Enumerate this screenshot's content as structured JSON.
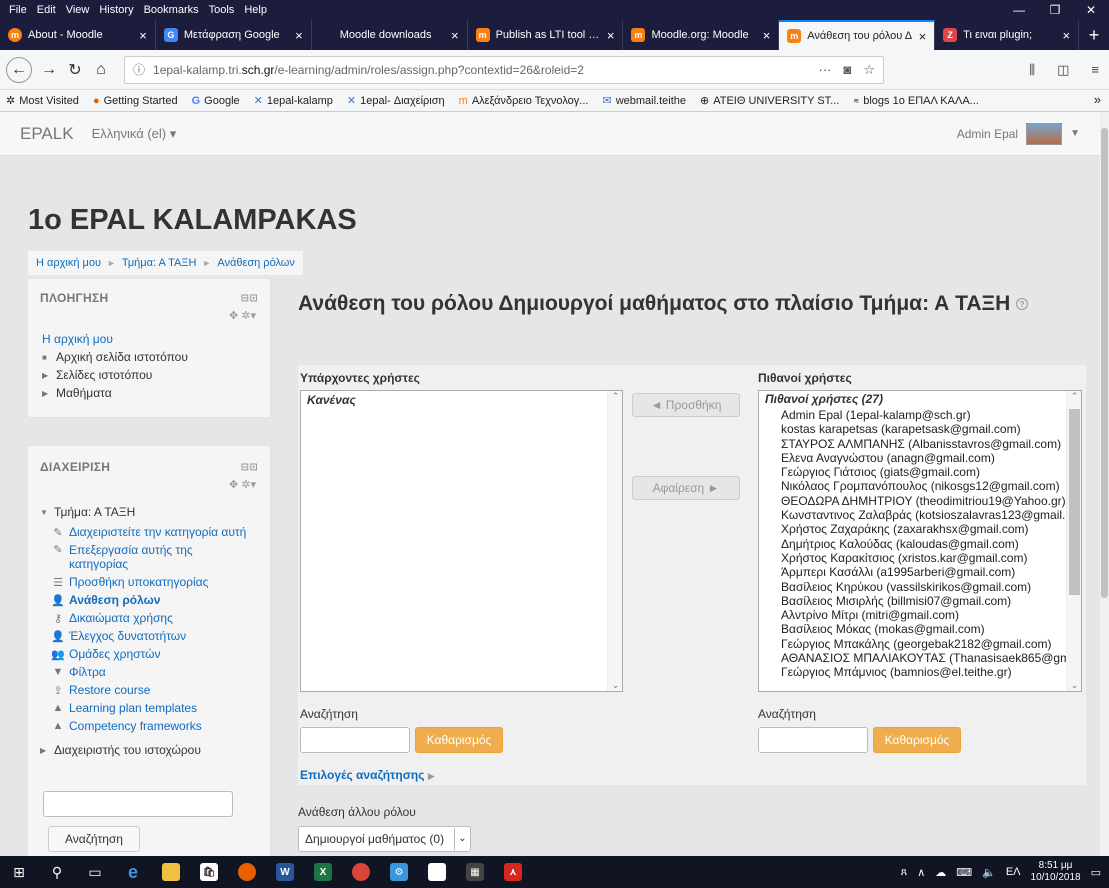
{
  "menubar": {
    "items": [
      "File",
      "Edit",
      "View",
      "History",
      "Bookmarks",
      "Tools",
      "Help"
    ]
  },
  "tabs": [
    {
      "title": "About - Moodle",
      "icon": "moodle-icon",
      "color": "#f98012"
    },
    {
      "title": "Μετάφραση Google",
      "icon": "google-translate-icon",
      "color": "#4285f4"
    },
    {
      "title": "Moodle downloads",
      "icon": "page-icon",
      "color": "#1c1c3c"
    },
    {
      "title": "Publish as LTI tool - M",
      "icon": "moodle-icon",
      "color": "#f98012"
    },
    {
      "title": "Moodle.org: Moodle",
      "icon": "moodle-icon",
      "color": "#f98012"
    },
    {
      "title": "Ανάθεση του ρόλου Δ",
      "icon": "moodle-icon",
      "color": "#f98012"
    },
    {
      "title": "Τι ειναι plugin;",
      "icon": "pin-icon",
      "color": "#e0454c"
    }
  ],
  "navbar": {
    "url_prefix": "1epal-kalamp.tri.",
    "url_domain": "sch.gr",
    "url_suffix": "/e-learning/admin/roles/assign.php?contextid=26&roleid=2"
  },
  "bookmarks": [
    {
      "label": "Most Visited",
      "icon": "gear-icon"
    },
    {
      "label": "Getting Started",
      "icon": "firefox-icon"
    },
    {
      "label": "Google",
      "icon": "google-icon"
    },
    {
      "label": "1epal-kalamp",
      "icon": "moodle-icon"
    },
    {
      "label": "1epal- Διαχείριση",
      "icon": "moodle-icon"
    },
    {
      "label": "Αλεξάνδρειο Τεχνολογ...",
      "icon": "moodle-icon"
    },
    {
      "label": "webmail.teithe",
      "icon": "mail-icon"
    },
    {
      "label": "ATEIΘ UNIVERSITY ST...",
      "icon": "globe-icon"
    },
    {
      "label": "blogs 1ο ΕΠΑΛ ΚΑΛΑ...",
      "icon": "blog-icon"
    }
  ],
  "topnav": {
    "brand": "EPALK",
    "language": "Ελληνικά (el) ▾",
    "user": "Admin Epal"
  },
  "page": {
    "title": "1o EPAL KALAMPAKAS",
    "breadcrumb": [
      "Η αρχική μου",
      "Τμήμα: Α ΤΑΞΗ",
      "Ανάθεση ρόλων"
    ]
  },
  "nav_block": {
    "title": "ΠΛΟΗΓΗΣΗ",
    "home": "Η αρχική μου",
    "items": [
      "Αρχική σελίδα ιστοτόπου",
      "Σελίδες ιστοτόπου",
      "Μαθήματα"
    ]
  },
  "admin_block": {
    "title": "ΔΙΑΧΕΙΡΙΣΗ",
    "category": "Τμήμα: Α ΤΑΞΗ",
    "items": [
      {
        "label": "Διαχειριστείτε την κατηγορία αυτή",
        "icon": "pencil-icon"
      },
      {
        "label": "Επεξεργασία αυτής της κατηγορίας",
        "icon": "pencil-icon"
      },
      {
        "label": "Προσθήκη υποκατηγορίας",
        "icon": "list-icon"
      },
      {
        "label": "Ανάθεση ρόλων",
        "icon": "user-icon"
      },
      {
        "label": "Δικαιώματα χρήσης",
        "icon": "key-icon"
      },
      {
        "label": "Έλεγχος δυνατοτήτων",
        "icon": "user-check-icon"
      },
      {
        "label": "Ομάδες χρηστών",
        "icon": "users-icon"
      },
      {
        "label": "Φίλτρα",
        "icon": "filter-icon"
      },
      {
        "label": "Restore course",
        "icon": "upload-icon"
      },
      {
        "label": "Learning plan templates",
        "icon": "triangle-icon"
      },
      {
        "label": "Competency frameworks",
        "icon": "triangle-icon"
      }
    ],
    "site_admin": "Διαχειριστής του ιστοχώρου",
    "search_button": "Αναζήτηση"
  },
  "main": {
    "heading": "Ανάθεση του ρόλου Δημιουργοί μαθήματος στο πλαίσιο Τμήμα: Α ΤΑΞΗ",
    "existing_label": "Υπάρχοντες χρήστες",
    "existing_group": "Κανένας",
    "potential_label": "Πιθανοί χρήστες",
    "potential_group": "Πιθανοί χρήστες (27)",
    "potential_users": [
      "Admin Epal (1epal-kalamp@sch.gr)",
      "kostas karapetsas (karapetsask@gmail.com)",
      "ΣΤΑΥΡΟΣ ΑΛΜΠΑΝΗΣ (Albanisstavros@gmail.com)",
      "Ελενα Αναγνώστου (anagn@gmail.com)",
      "Γεώργιος Γιάτσιος (giats@gmail.com)",
      "Νικόλαος Γρομπανόπουλος (nikosgs12@gmail.com)",
      "ΘΕΟΔΩΡΑ ΔΗΜΗΤΡΙΟΥ (theodimitriou19@Yahoo.gr)",
      "Κωνσταντινος Ζαλαβράς (kotsioszalavras123@gmail.c",
      "Χρήστος Ζαχαράκης (zaxarakhsx@gmail.com)",
      "Δημήτριος Καλούδας (kaloudas@gmail.com)",
      "Χρήστος Καρακίτσιος (xristos.kar@gmail.com)",
      "Άρμπερι Κασάλλι (a1995arberi@gmail.com)",
      "Βασίλειος Κηρύκου (vassilskirikos@gmail.com)",
      "Βασίλειος Μισιρλής (billmisi07@gmail.com)",
      "Αλντρίνο Μίτρι (mitri@gmail.com)",
      "Βασίλειος Μόκας (mokas@gmail.com)",
      "Γεώργιος Μπακάλης (georgebak2182@gmail.com)",
      "ΑΘΑΝΑΣΙΟΣ ΜΠΑΛΙΑΚΟΥΤΑΣ (Thanasisaek865@gmail.",
      "Γεώργιος Μπάμνιος (bamnios@el.teithe.gr)"
    ],
    "add_button": "◄ Προσθήκη",
    "remove_button": "Αφαίρεση ►",
    "search_label": "Αναζήτηση",
    "clear_button": "Καθαρισμός",
    "search_options": "Επιλογές αναζήτησης",
    "other_role_label": "Ανάθεση άλλου ρόλου",
    "other_role_value": "Δημιουργοί μαθήματος (0)"
  },
  "taskbar": {
    "lang": "ΕΛ",
    "time": "8:51 μμ",
    "date": "10/10/2018"
  }
}
